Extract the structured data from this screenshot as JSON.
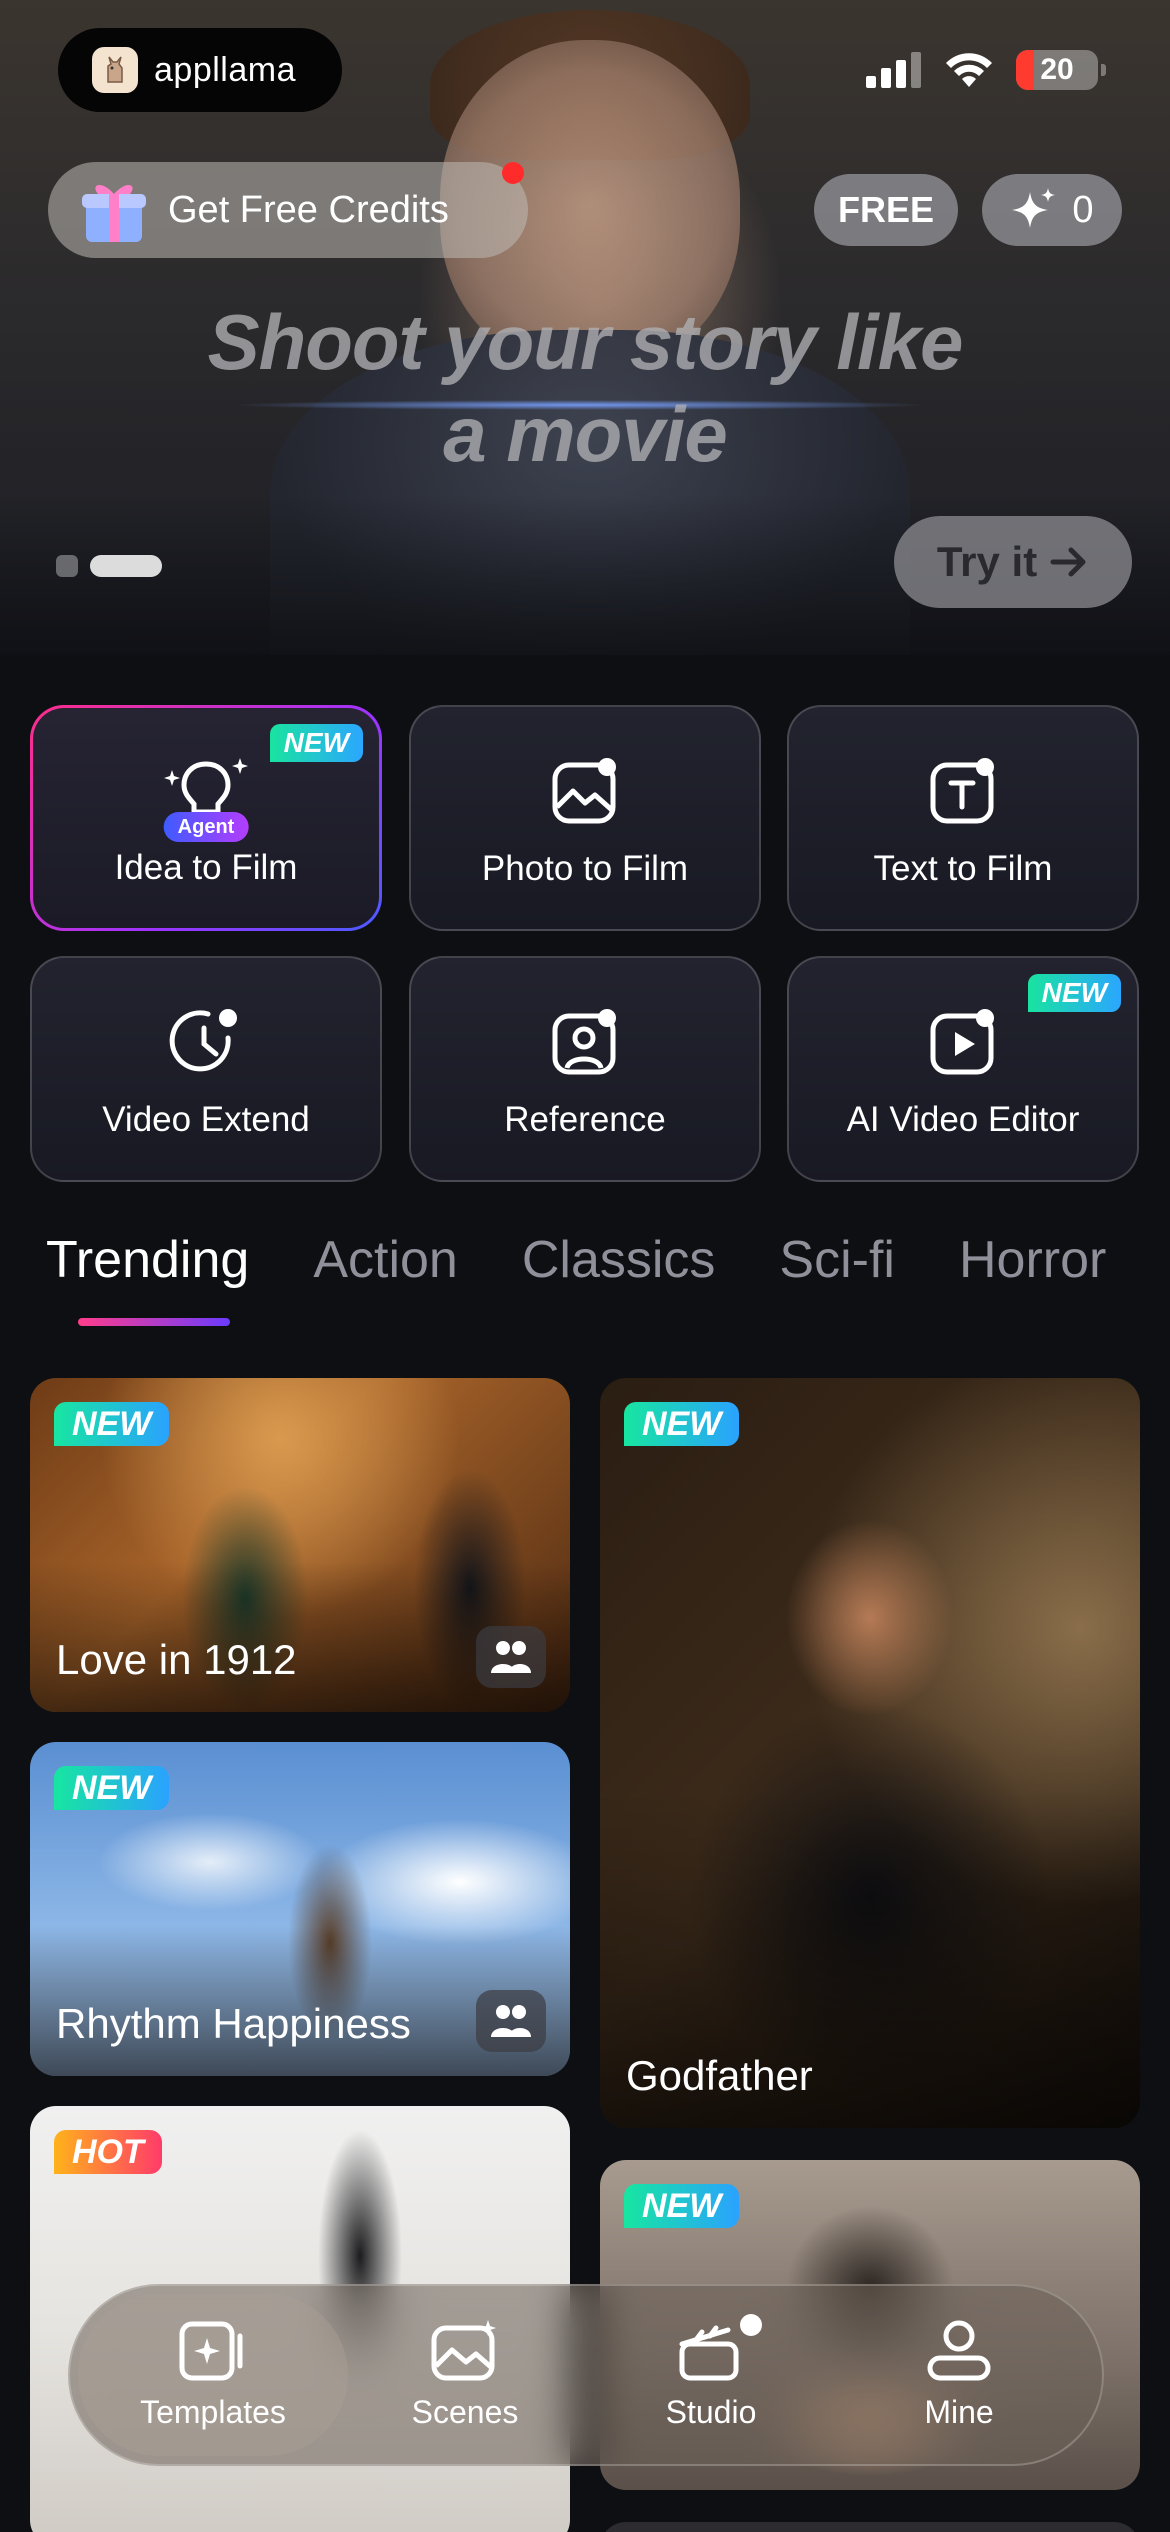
{
  "status_bar": {
    "battery": "20"
  },
  "hero": {
    "logo_text": "appllama",
    "credits_label": "Get Free Credits",
    "free_label": "FREE",
    "spark_count": "0",
    "headline_line1": "Shoot your story like",
    "headline_line2": "a movie",
    "try_label": "Try it",
    "carousel_pages": 2,
    "carousel_active": 2
  },
  "tools": [
    {
      "label": "Idea to Film",
      "badge": "NEW",
      "chip": "Agent",
      "icon": "lightbulb-icon"
    },
    {
      "label": "Photo to Film",
      "icon": "photo-icon"
    },
    {
      "label": "Text to Film",
      "icon": "text-icon"
    },
    {
      "label": "Video Extend",
      "icon": "clock-icon"
    },
    {
      "label": "Reference",
      "icon": "person-icon"
    },
    {
      "label": "AI Video Editor",
      "badge": "NEW",
      "icon": "play-edit-icon"
    }
  ],
  "tabs": [
    "Trending",
    "Action",
    "Classics",
    "Sci-fi",
    "Horror"
  ],
  "active_tab": "Trending",
  "cards": [
    {
      "title": "Love in 1912",
      "badge": "NEW"
    },
    {
      "title": "Rhythm Happiness",
      "badge": "NEW"
    },
    {
      "title": "",
      "badge": "HOT"
    },
    {
      "title": "Godfather",
      "badge": "NEW"
    },
    {
      "title": "",
      "badge": "NEW"
    }
  ],
  "bottom_nav": [
    {
      "label": "Templates",
      "icon": "templates-icon",
      "active": true
    },
    {
      "label": "Scenes",
      "icon": "scenes-icon"
    },
    {
      "label": "Studio",
      "icon": "clapperboard-icon"
    },
    {
      "label": "Mine",
      "icon": "user-icon"
    }
  ],
  "colors": {
    "background": "#0e0f13",
    "new_badge": "#19e3a0",
    "hot_badge": "#ff3b6a",
    "tab_accent": "#ff3d8b",
    "notification_dot": "#ff2b2b"
  }
}
